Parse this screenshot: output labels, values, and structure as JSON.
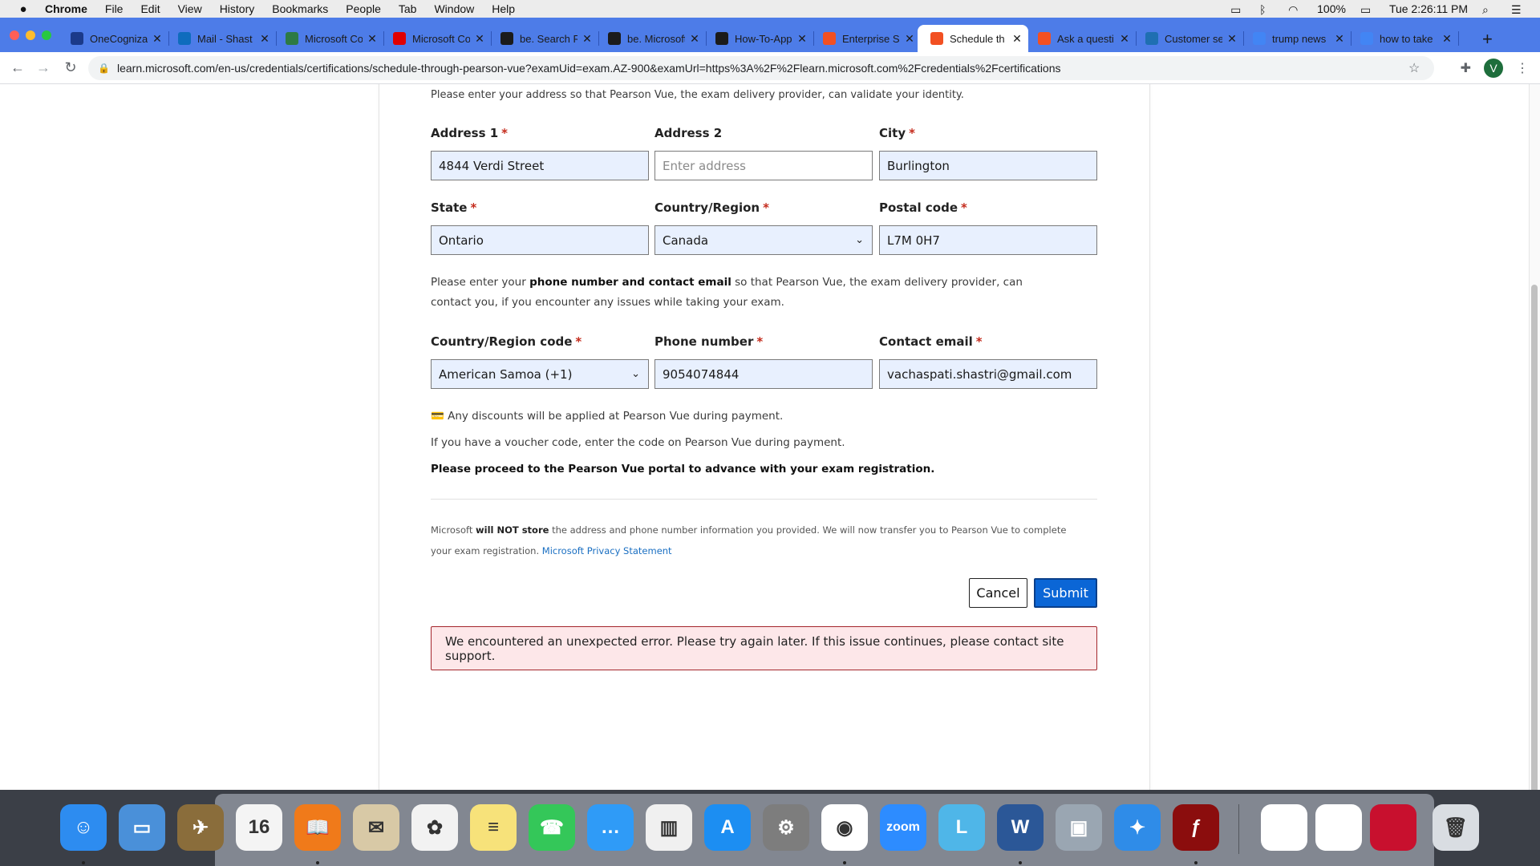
{
  "menubar": {
    "app": "Chrome",
    "items": [
      "File",
      "Edit",
      "View",
      "History",
      "Bookmarks",
      "People",
      "Tab",
      "Window",
      "Help"
    ],
    "battery": "100%",
    "clock": "Tue 2:26:11 PM"
  },
  "tabs": [
    {
      "title": "OneCogniza",
      "favicon": "onecognizant-icon",
      "color": "#1b3a8a"
    },
    {
      "title": "Mail - Shast",
      "favicon": "outlook-icon",
      "color": "#0f6cbd"
    },
    {
      "title": "Microsoft Co",
      "favicon": "teams-icon",
      "color": "#2d7a44"
    },
    {
      "title": "Microsoft Co",
      "favicon": "youtube-icon",
      "color": "#e00000"
    },
    {
      "title": "be. Search Resu",
      "favicon": "behance-icon",
      "color": "#1b1b1b"
    },
    {
      "title": "be. Microsoft Co",
      "favicon": "behance-icon",
      "color": "#1b1b1b"
    },
    {
      "title": "How-To-App",
      "favicon": "github-icon",
      "color": "#1b1b1b"
    },
    {
      "title": "Enterprise S",
      "favicon": "microsoft-icon",
      "color": "#f25022"
    },
    {
      "title": "Schedule th",
      "favicon": "microsoft-icon",
      "color": "#f25022"
    },
    {
      "title": "Ask a questi",
      "favicon": "microsoft-icon",
      "color": "#f25022"
    },
    {
      "title": "Customer se",
      "favicon": "pearson-icon",
      "color": "#1f6fb2"
    },
    {
      "title": "trump news",
      "favicon": "google-icon",
      "color": "#4285f4"
    },
    {
      "title": "how to take",
      "favicon": "google-icon",
      "color": "#4285f4"
    }
  ],
  "active_tab_index": 8,
  "toolbar": {
    "url": "learn.microsoft.com/en-us/credentials/certifications/schedule-through-pearson-vue?examUid=exam.AZ-900&examUrl=https%3A%2F%2Flearn.microsoft.com%2Fcredentials%2Fcertifications",
    "profile_initial": "V"
  },
  "form": {
    "intro": "Please enter your address so that Pearson Vue, the exam delivery provider, can validate your identity.",
    "address1": {
      "label": "Address 1",
      "value": "4844 Verdi Street"
    },
    "address2": {
      "label": "Address 2",
      "placeholder": "Enter address"
    },
    "city": {
      "label": "City",
      "value": "Burlington"
    },
    "state": {
      "label": "State",
      "value": "Ontario"
    },
    "country": {
      "label": "Country/Region",
      "value": "Canada"
    },
    "postal": {
      "label": "Postal code",
      "value": "L7M 0H7"
    },
    "contact_intro_1": "Please enter your ",
    "contact_intro_bold": "phone number and contact email",
    "contact_intro_2": " so that Pearson Vue, the exam delivery provider, can contact you, if you encounter any issues while taking your exam.",
    "country_code": {
      "label": "Country/Region code",
      "value": "American Samoa (+1)"
    },
    "phone": {
      "label": "Phone number",
      "value": "9054074844"
    },
    "email": {
      "label": "Contact email",
      "value": "vachaspati.shastri@gmail.com"
    },
    "discount_note": "Any discounts will be applied at Pearson Vue during payment.",
    "voucher_note": "If you have a voucher code, enter the code on Pearson Vue during payment.",
    "proceed_note": "Please proceed to the Pearson Vue portal to advance with your exam registration.",
    "privacy_1": "Microsoft ",
    "privacy_bold": "will NOT store",
    "privacy_2": " the address and phone number information you provided. We will now transfer you to Pearson Vue to complete your exam registration. ",
    "privacy_link": "Microsoft Privacy Statement",
    "cancel": "Cancel",
    "submit": "Submit",
    "error": "We encountered an unexpected error. Please try again later. If this issue continues, please contact site support."
  },
  "dock": [
    {
      "name": "finder-icon",
      "color": "#2d8cf0",
      "glyph": "☺"
    },
    {
      "name": "keynote-icon",
      "color": "#4a90d9",
      "glyph": "▭"
    },
    {
      "name": "preview-icon",
      "color": "#8a6d3b",
      "glyph": "✈"
    },
    {
      "name": "calendar-icon",
      "color": "#f4f4f4",
      "glyph": "16"
    },
    {
      "name": "books-icon",
      "color": "#f07a1a",
      "glyph": "📖"
    },
    {
      "name": "contacts-icon",
      "color": "#d8c9a6",
      "glyph": "✉"
    },
    {
      "name": "photos-icon",
      "color": "#f2f2f2",
      "glyph": "✿"
    },
    {
      "name": "notes-icon",
      "color": "#f7e27a",
      "glyph": "≡"
    },
    {
      "name": "facetime-icon",
      "color": "#34c759",
      "glyph": "☎"
    },
    {
      "name": "messages-icon",
      "color": "#2f9bf7",
      "glyph": "…"
    },
    {
      "name": "numbers-icon",
      "color": "#f0f0f0",
      "glyph": "▥"
    },
    {
      "name": "app-store-icon",
      "color": "#1c8ef2",
      "glyph": "A"
    },
    {
      "name": "system-preferences-icon",
      "color": "#7d7d7d",
      "glyph": "⚙"
    },
    {
      "name": "chrome-icon",
      "color": "#ffffff",
      "glyph": "◉"
    },
    {
      "name": "zoom-icon",
      "color": "#2d8cff",
      "glyph": "zoom"
    },
    {
      "name": "lync-icon",
      "color": "#4fb6e8",
      "glyph": "L"
    },
    {
      "name": "word-icon",
      "color": "#2b5797",
      "glyph": "W"
    },
    {
      "name": "image-capture-icon",
      "color": "#9aa6b2",
      "glyph": "▣"
    },
    {
      "name": "safari-icon",
      "color": "#2f8ce8",
      "glyph": "✦"
    },
    {
      "name": "flash-icon",
      "color": "#8b0d0d",
      "glyph": "ƒ"
    },
    {
      "name": "document-thumb-1",
      "color": "#ffffff",
      "glyph": ""
    },
    {
      "name": "document-thumb-2",
      "color": "#ffffff",
      "glyph": ""
    },
    {
      "name": "document-thumb-3",
      "color": "#c8102e",
      "glyph": ""
    },
    {
      "name": "trash-icon",
      "color": "#d9dde2",
      "glyph": "🗑"
    }
  ]
}
